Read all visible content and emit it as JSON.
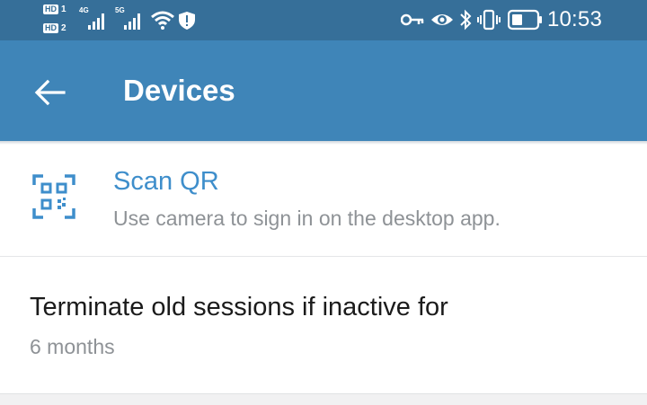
{
  "status_bar": {
    "sim1_label": "HD",
    "sim1_num": "1",
    "sim2_label": "HD",
    "sim2_num": "2",
    "net1": "4G",
    "net2": "5G",
    "time": "10:53",
    "icons": [
      "key-icon",
      "eye-icon",
      "bluetooth-icon",
      "vibrate-icon",
      "battery-icon"
    ],
    "bar_color": "#366f99"
  },
  "app_bar": {
    "title": "Devices",
    "color": "#3f85b8"
  },
  "scan_qr": {
    "title": "Scan QR",
    "subtitle": "Use camera to sign in on the desktop app.",
    "accent": "#3e8ecb",
    "icon": "qr-code-icon"
  },
  "terminate_sessions": {
    "title": "Terminate old sessions if inactive for",
    "value": "6 months"
  }
}
